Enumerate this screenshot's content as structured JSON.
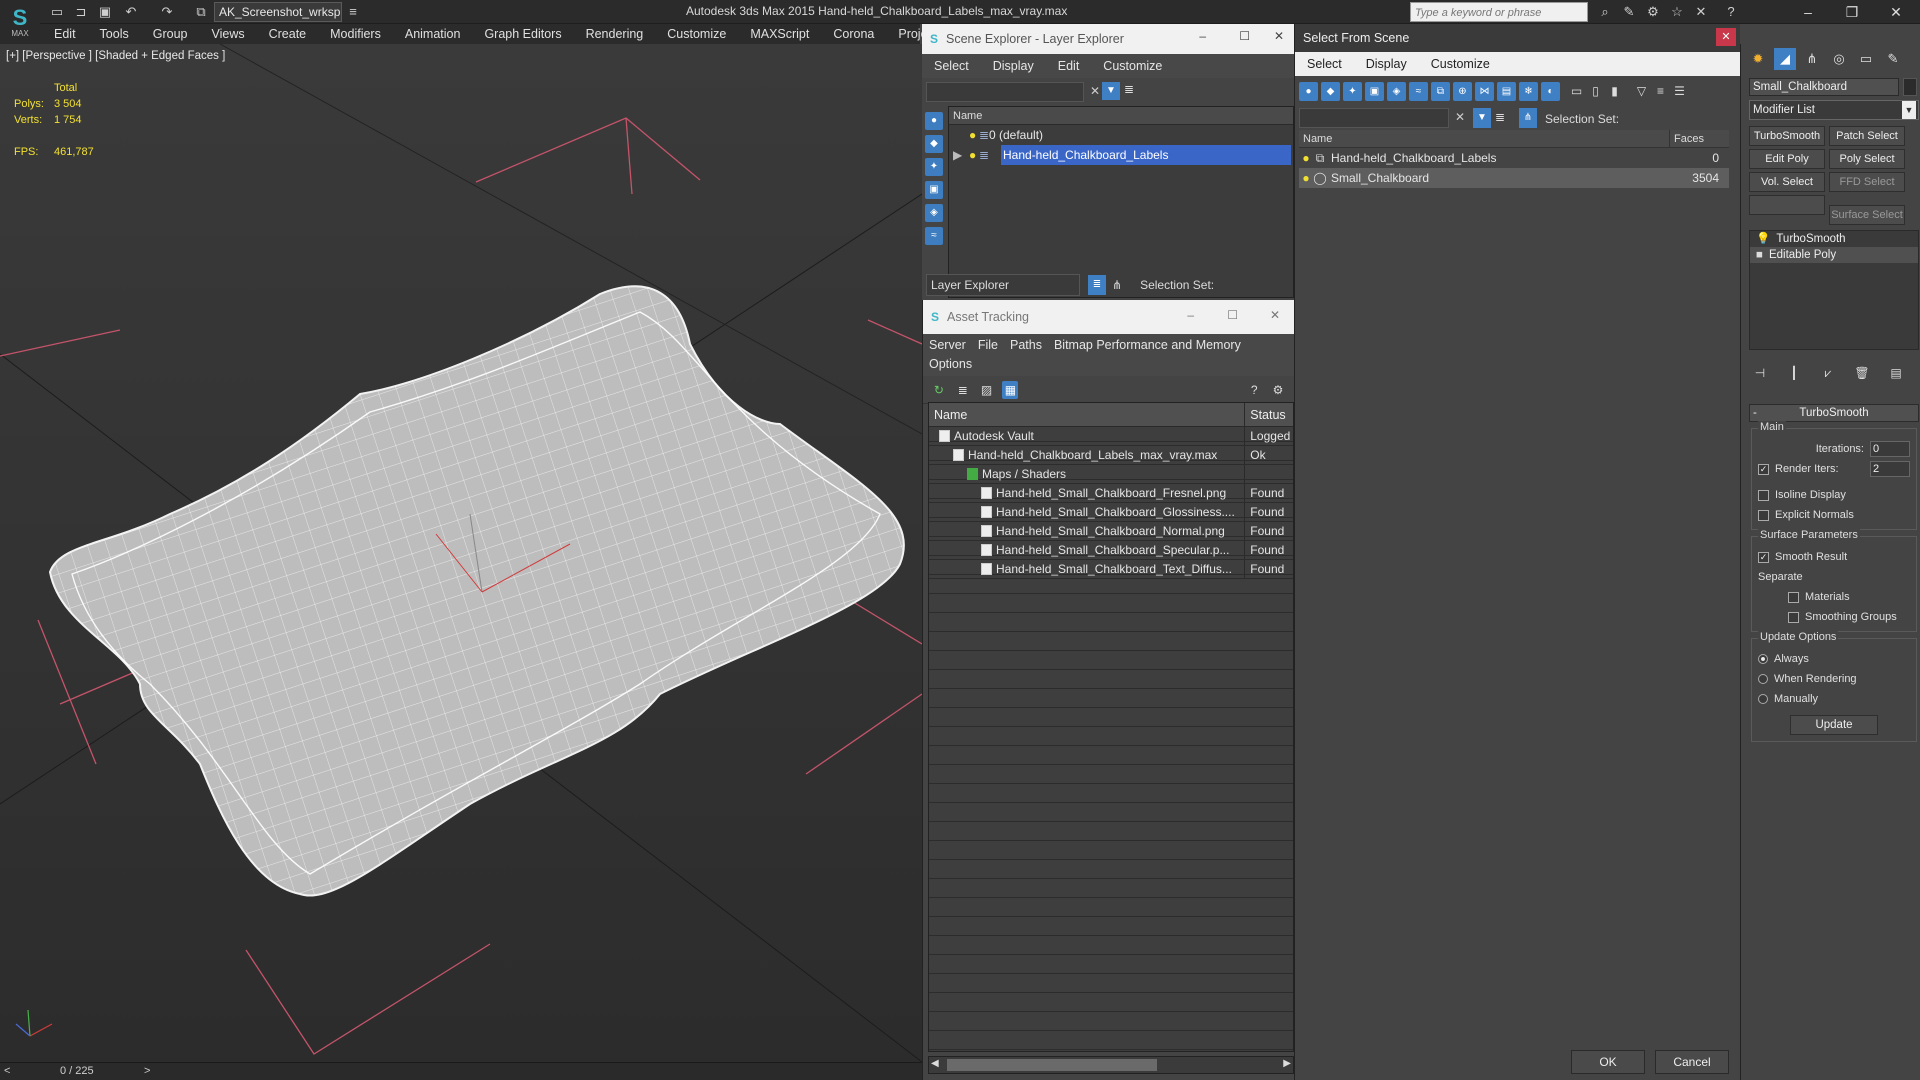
{
  "app": {
    "logo_sub": "MAX",
    "workspace": "AK_Screenshot_wrksp",
    "title": "Autodesk 3ds Max  2015      Hand-held_Chalkboard_Labels_max_vray.max",
    "search_placeholder": "Type a keyword or phrase"
  },
  "menubar": [
    "Edit",
    "Tools",
    "Group",
    "Views",
    "Create",
    "Modifiers",
    "Animation",
    "Graph Editors",
    "Rendering",
    "Customize",
    "MAXScript",
    "Corona",
    "Project Man"
  ],
  "viewport": {
    "label": "[+] [Perspective ] [Shaded + Edged Faces ]",
    "stats": {
      "total_label": "Total",
      "polys_label": "Polys:",
      "polys_value": "3 504",
      "verts_label": "Verts:",
      "verts_value": "1 754",
      "fps_label": "FPS:",
      "fps_value": "461,787"
    },
    "timeline": "0 / 225"
  },
  "scene_explorer": {
    "title": "Scene Explorer - Layer Explorer",
    "menu": [
      "Select",
      "Display",
      "Edit",
      "Customize"
    ],
    "col_name": "Name",
    "layers": [
      {
        "name": "0 (default)",
        "selected": false
      },
      {
        "name": "Hand-held_Chalkboard_Labels",
        "selected": true
      }
    ],
    "footer_label": "Layer Explorer",
    "selection_set_label": "Selection Set:"
  },
  "asset_tracking": {
    "title": "Asset Tracking",
    "menu_line1": [
      "Server",
      "File",
      "Paths",
      "Bitmap Performance and Memory"
    ],
    "menu_line2": [
      "Options"
    ],
    "col_name": "Name",
    "col_status": "Status",
    "rows": [
      {
        "name": "Autodesk Vault",
        "status": "Logged",
        "indent": 0
      },
      {
        "name": "Hand-held_Chalkboard_Labels_max_vray.max",
        "status": "Ok",
        "indent": 1
      },
      {
        "name": "Maps / Shaders",
        "status": "",
        "indent": 2
      },
      {
        "name": "Hand-held_Small_Chalkboard_Fresnel.png",
        "status": "Found",
        "indent": 3
      },
      {
        "name": "Hand-held_Small_Chalkboard_Glossiness....",
        "status": "Found",
        "indent": 3
      },
      {
        "name": "Hand-held_Small_Chalkboard_Normal.png",
        "status": "Found",
        "indent": 3
      },
      {
        "name": "Hand-held_Small_Chalkboard_Specular.p...",
        "status": "Found",
        "indent": 3
      },
      {
        "name": "Hand-held_Small_Chalkboard_Text_Diffus...",
        "status": "Found",
        "indent": 3
      }
    ]
  },
  "select_from_scene": {
    "title": "Select From Scene",
    "menu": [
      "Select",
      "Display",
      "Customize"
    ],
    "selection_set_label": "Selection Set:",
    "col_name": "Name",
    "col_faces": "Faces",
    "rows": [
      {
        "name": "Hand-held_Chalkboard_Labels",
        "faces": "0",
        "highlight": false
      },
      {
        "name": "Small_Chalkboard",
        "faces": "3504",
        "highlight": true
      }
    ],
    "ok_label": "OK",
    "cancel_label": "Cancel"
  },
  "command_panel": {
    "object_name": "Small_Chalkboard",
    "modifier_list": "Modifier List",
    "buttons": [
      {
        "label": "TurboSmooth",
        "disabled": false
      },
      {
        "label": "Patch Select",
        "disabled": false
      },
      {
        "label": "Edit Poly",
        "disabled": false
      },
      {
        "label": "Poly Select",
        "disabled": false
      },
      {
        "label": "Vol. Select",
        "disabled": false
      },
      {
        "label": "FFD Select",
        "disabled": true
      },
      {
        "label": "",
        "disabled": true
      },
      {
        "label": "Surface Select",
        "disabled": true
      }
    ],
    "stack": [
      "TurboSmooth",
      "Editable Poly"
    ],
    "rollout_title": "TurboSmooth",
    "main_group": "Main",
    "iterations_label": "Iterations:",
    "iterations_value": "0",
    "render_iters_label": "Render Iters:",
    "render_iters_value": "2",
    "isoline_label": "Isoline Display",
    "explicit_normals_label": "Explicit Normals",
    "surface_group": "Surface Parameters",
    "smooth_result_label": "Smooth Result",
    "separate_label": "Separate",
    "materials_label": "Materials",
    "smoothing_groups_label": "Smoothing Groups",
    "update_group": "Update Options",
    "always_label": "Always",
    "when_rendering_label": "When Rendering",
    "manually_label": "Manually",
    "update_button": "Update"
  }
}
